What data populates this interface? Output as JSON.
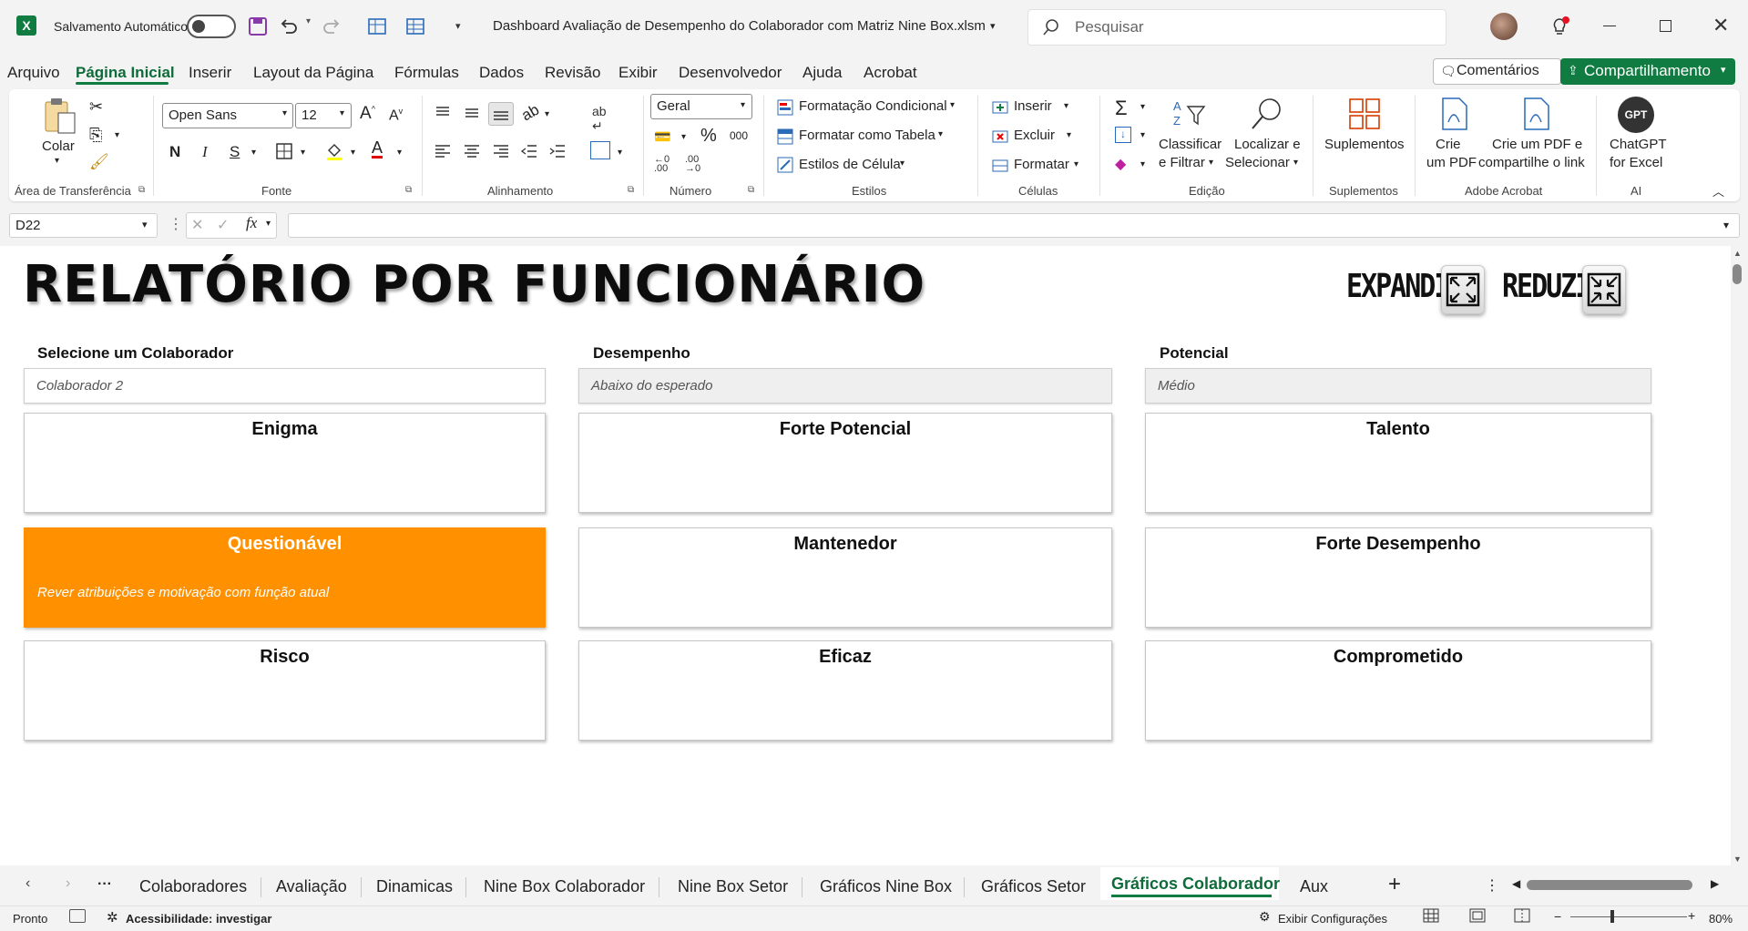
{
  "titlebar": {
    "autosave_label": "Salvamento Automático",
    "filename": "Dashboard Avaliação de Desempenho do Colaborador com Matriz Nine Box.xlsm",
    "search_placeholder": "Pesquisar"
  },
  "menu": {
    "items": [
      "Arquivo",
      "Página Inicial",
      "Inserir",
      "Layout da Página",
      "Fórmulas",
      "Dados",
      "Revisão",
      "Exibir",
      "Desenvolvedor",
      "Ajuda",
      "Acrobat"
    ],
    "comments": "Comentários",
    "share": "Compartilhamento"
  },
  "ribbon": {
    "clipboard": {
      "paste": "Colar",
      "label": "Área de Transferência"
    },
    "font": {
      "name": "Open Sans",
      "size": "12",
      "bold": "N",
      "italic": "I",
      "underline": "S",
      "label": "Fonte"
    },
    "alignment": {
      "label": "Alinhamento"
    },
    "number": {
      "format": "Geral",
      "percent": "%",
      "thousands": "000",
      "label": "Número"
    },
    "styles": {
      "conditional": "Formatação Condicional",
      "as_table": "Formatar como Tabela",
      "cell_styles": "Estilos de Célula",
      "label": "Estilos"
    },
    "cells": {
      "insert": "Inserir",
      "delete": "Excluir",
      "format": "Formatar",
      "label": "Células"
    },
    "editing": {
      "sort_l1": "Classificar",
      "sort_l2": "e Filtrar",
      "find_l1": "Localizar e",
      "find_l2": "Selecionar",
      "label": "Edição"
    },
    "addins": {
      "btn": "Suplementos",
      "label": "Suplementos"
    },
    "acrobat": {
      "pdf_l1": "Crie",
      "pdf_l2": "um PDF",
      "share_l1": "Crie um PDF e",
      "share_l2": "compartilhe o link",
      "label": "Adobe Acrobat"
    },
    "ai": {
      "gpt_icon": "GPT",
      "l1": "ChatGPT",
      "l2": "for Excel",
      "label": "AI"
    }
  },
  "formula_bar": {
    "cell_ref": "D22",
    "fx": "fx",
    "value": ""
  },
  "report": {
    "title": "RELATÓRIO POR FUNCIONÁRIO",
    "expand": "EXPANDIR",
    "reduce": "REDUZIR",
    "fields": [
      {
        "label": "Selecione um Colaborador",
        "value": "Colaborador 2"
      },
      {
        "label": "Desempenho",
        "value": "Abaixo do esperado"
      },
      {
        "label": "Potencial",
        "value": "Médio"
      }
    ],
    "grid": [
      {
        "title": "Enigma",
        "desc": ""
      },
      {
        "title": "Forte Potencial",
        "desc": ""
      },
      {
        "title": "Talento",
        "desc": ""
      },
      {
        "title": "Questionável",
        "desc": "Rever atribuições e motivação com função atual",
        "highlight": true
      },
      {
        "title": "Mantenedor",
        "desc": ""
      },
      {
        "title": "Forte Desempenho",
        "desc": ""
      },
      {
        "title": "Risco",
        "desc": ""
      },
      {
        "title": "Eficaz",
        "desc": ""
      },
      {
        "title": "Comprometido",
        "desc": ""
      }
    ],
    "highlight_color": "#ff9100"
  },
  "sheet_tabs": {
    "more": "···",
    "tabs": [
      "Colaboradores",
      "Avaliação",
      "Dinamicas",
      "Nine Box Colaborador",
      "Nine Box Setor",
      "Gráficos Nine Box",
      "Gráficos Setor",
      "Gráficos Colaborador",
      "Aux"
    ],
    "active": "Gráficos Colaborador",
    "add": "+"
  },
  "status": {
    "ready": "Pronto",
    "accessibility": "Acessibilidade: investigar",
    "display_settings": "Exibir Configurações",
    "zoom": "80%"
  },
  "colors": {
    "excel_green": "#107c41",
    "accent_text": "#0f6b3a"
  }
}
